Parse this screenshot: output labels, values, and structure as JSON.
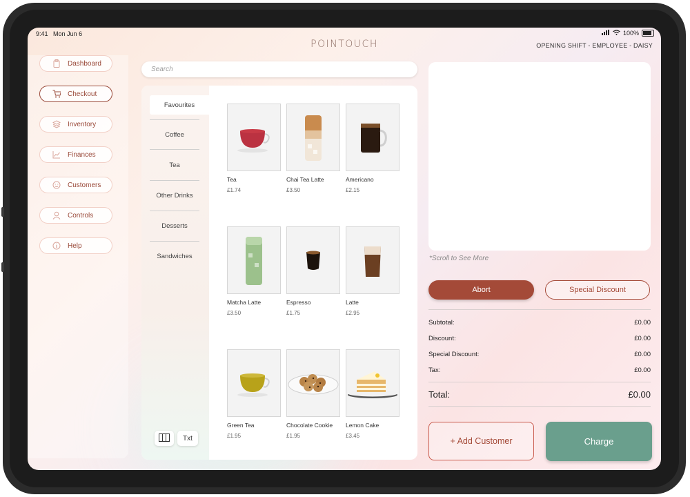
{
  "status_bar": {
    "time": "9:41",
    "date": "Mon Jun 6",
    "battery": "100%"
  },
  "brand": "POINTOUCH",
  "shift_info": "OPENING SHIFT - EMPLOYEE - DAISY",
  "sidebar": {
    "items": [
      {
        "label": "Dashboard",
        "icon": "clipboard-icon",
        "active": false
      },
      {
        "label": "Checkout",
        "icon": "cart-icon",
        "active": true
      },
      {
        "label": "Inventory",
        "icon": "layers-icon",
        "active": false
      },
      {
        "label": "Finances",
        "icon": "chart-line-icon",
        "active": false
      },
      {
        "label": "Customers",
        "icon": "smile-icon",
        "active": false
      },
      {
        "label": "Controls",
        "icon": "user-icon",
        "active": false
      },
      {
        "label": "Help",
        "icon": "info-icon",
        "active": false
      }
    ]
  },
  "search": {
    "placeholder": "Search"
  },
  "categories": [
    "Favourites",
    "Coffee",
    "Tea",
    "Other Drinks",
    "Desserts",
    "Sandwiches"
  ],
  "view_toggle": {
    "grid_icon": "grid-icon",
    "text_label": "Txt"
  },
  "products": [
    {
      "name": "Tea",
      "price": "£1.74"
    },
    {
      "name": "Chai Tea Latte",
      "price": "£3.50"
    },
    {
      "name": "Americano",
      "price": "£2.15"
    },
    {
      "name": "Matcha Latte",
      "price": "£3.50"
    },
    {
      "name": "Espresso",
      "price": "£1.75"
    },
    {
      "name": "Latte",
      "price": "£2.95"
    },
    {
      "name": "Green Tea",
      "price": "£1.95"
    },
    {
      "name": "Chocolate Cookie",
      "price": "£1.95"
    },
    {
      "name": "Lemon Cake",
      "price": "£3.45"
    }
  ],
  "order": {
    "scroll_note": "*Scroll to See More",
    "abort_label": "Abort",
    "special_discount_label": "Special Discount",
    "summary": [
      {
        "label": "Subtotal:",
        "value": "£0.00"
      },
      {
        "label": "Discount:",
        "value": "£0.00"
      },
      {
        "label": "Special Discount:",
        "value": "£0.00"
      },
      {
        "label": "Tax:",
        "value": "£0.00"
      }
    ],
    "total_label": "Total:",
    "total_value": "£0.00",
    "add_customer_label": "+ Add Customer",
    "charge_label": "Charge"
  },
  "colors": {
    "accent": "#a44a38",
    "charge": "#6a9f8d"
  }
}
